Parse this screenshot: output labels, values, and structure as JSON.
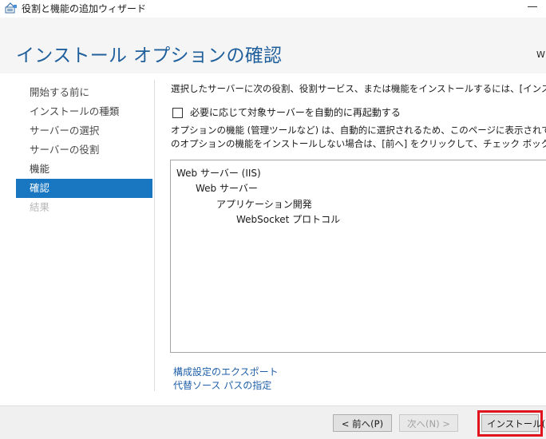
{
  "window": {
    "title": "役割と機能の追加ウィザード"
  },
  "header": {
    "heading": "インストール オプションの確認",
    "server_name_partial": "W"
  },
  "nav": {
    "items": [
      {
        "label": "開始する前に",
        "state": "normal"
      },
      {
        "label": "インストールの種類",
        "state": "normal"
      },
      {
        "label": "サーバーの選択",
        "state": "normal"
      },
      {
        "label": "サーバーの役割",
        "state": "normal"
      },
      {
        "label": "機能",
        "state": "normal"
      },
      {
        "label": "確認",
        "state": "active"
      },
      {
        "label": "結果",
        "state": "disabled"
      }
    ]
  },
  "main": {
    "intro_text": "選択したサーバーに次の役割、役割サービス、または機能をインストールするには、[インストール] をクリック",
    "restart_checkbox_label": "必要に応じて対象サーバーを自動的に再起動する",
    "restart_checked": false,
    "optional_text_line1": "オプションの機能 (管理ツールなど) は、自動的に選択されるため、このページに表示されている可能性が",
    "optional_text_line2": "のオプションの機能をインストールしない場合は、[前へ] をクリックして、チェック ボックスをオフにしてくださ",
    "features": [
      {
        "label": "Web サーバー (IIS)",
        "level": 0
      },
      {
        "label": "Web サーバー",
        "level": 1
      },
      {
        "label": "アプリケーション開発",
        "level": 2
      },
      {
        "label": "WebSocket プロトコル",
        "level": 3
      }
    ],
    "export_link": "構成設定のエクスポート",
    "alt_source_link": "代替ソース パスの指定"
  },
  "footer": {
    "prev_button": "< 前へ(P)",
    "next_button": "次へ(N) >",
    "install_button": "インストール(I)"
  },
  "colors": {
    "accent": "#1977c2",
    "heading": "#1f5f9c",
    "link": "#1f5fa8",
    "highlight": "#e0141e"
  }
}
